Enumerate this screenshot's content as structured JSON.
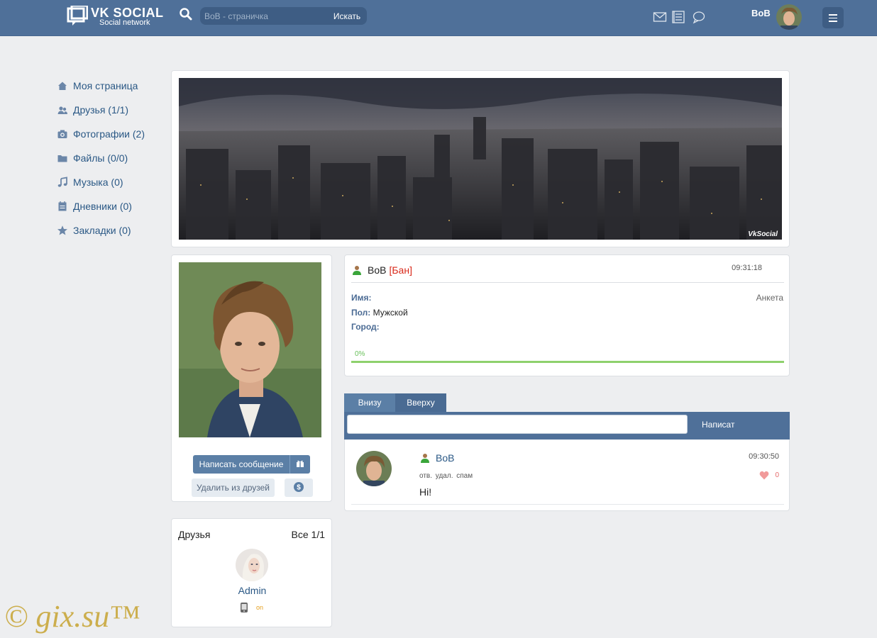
{
  "header": {
    "logo_title": "VK SOCIAL",
    "logo_sub": "Social network",
    "search_placeholder": "BoB - страничка",
    "search_button": "Искать",
    "user_name": "BoB",
    "icons": [
      "mail-icon",
      "news-icon",
      "chat-icon",
      "menu-icon"
    ]
  },
  "sidebar": {
    "items": [
      {
        "label": "Моя страница",
        "icon": "home-icon"
      },
      {
        "label": "Друзья (1/1)",
        "icon": "friends-icon"
      },
      {
        "label": "Фотографии (2)",
        "icon": "camera-icon"
      },
      {
        "label": "Файлы (0/0)",
        "icon": "folder-icon"
      },
      {
        "label": "Музыка (0)",
        "icon": "music-icon"
      },
      {
        "label": "Дневники (0)",
        "icon": "diary-icon"
      },
      {
        "label": "Закладки (0)",
        "icon": "star-icon"
      }
    ]
  },
  "cover": {
    "brand": "VkSocial"
  },
  "profile": {
    "message_button": "Написать сообщение",
    "remove_friend_button": "Удалить из друзей"
  },
  "friends": {
    "title": "Друзья",
    "all_label": "Все 1/1",
    "items": [
      {
        "name": "Admin",
        "status": "on"
      }
    ]
  },
  "info": {
    "name": "BoB",
    "ban": "[Бан]",
    "time": "09:31:18",
    "anketa": "Анкета",
    "fields": [
      {
        "label": "Имя:",
        "value": ""
      },
      {
        "label": "Пол:",
        "value": "Мужской"
      },
      {
        "label": "Город:",
        "value": ""
      }
    ],
    "progress_label": "0%",
    "progress": 0
  },
  "wall": {
    "tabs": [
      "Внизу",
      "Вверху"
    ],
    "send_label": "Написат",
    "post": {
      "user": "BoB",
      "time": "09:30:50",
      "actions": "отв. удал. спам",
      "text": "Hi!",
      "likes": "0"
    }
  },
  "watermark": "© gix.su™",
  "colors": {
    "header": "#4f7099",
    "link": "#2a5885",
    "ban": "#d9291a",
    "progress": "#8ed16d"
  }
}
